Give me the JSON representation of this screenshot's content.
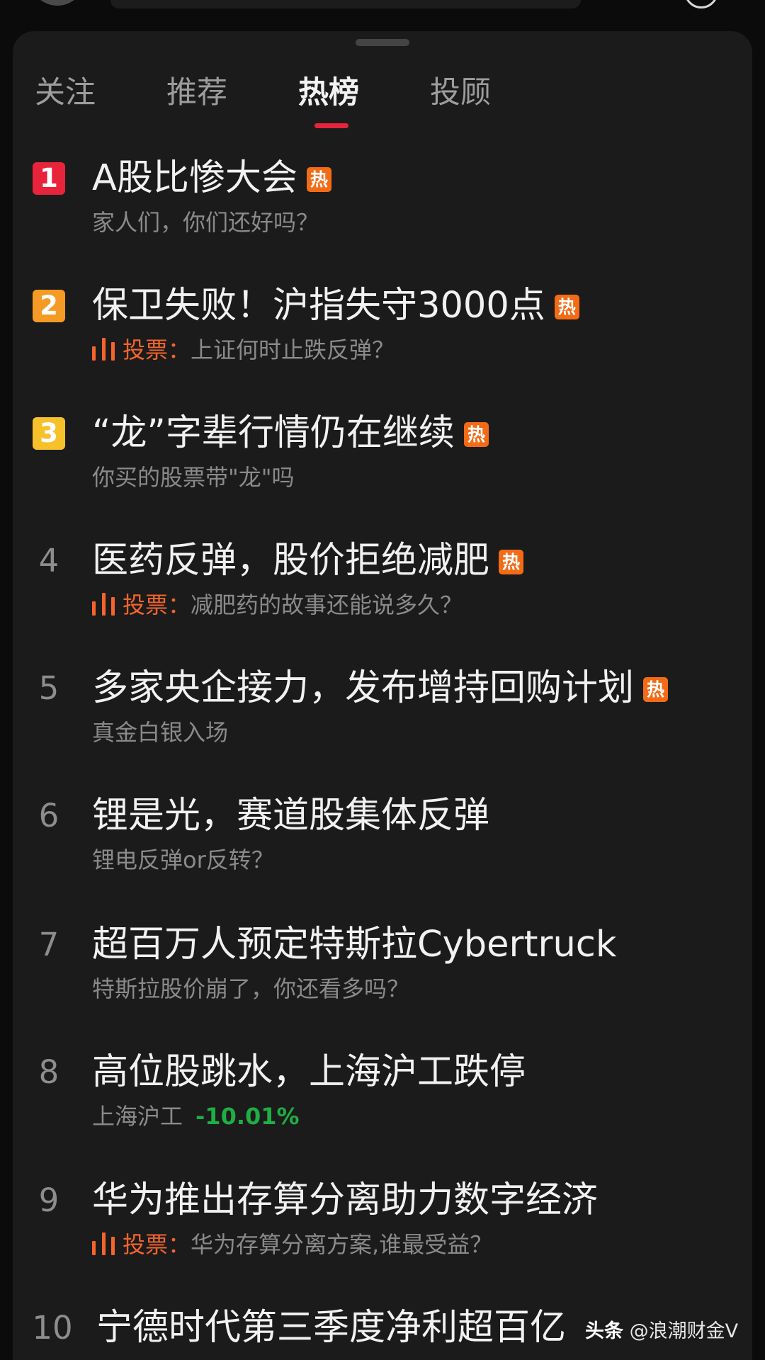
{
  "tabs": [
    {
      "label": "关注",
      "active": false
    },
    {
      "label": "推荐",
      "active": false
    },
    {
      "label": "热榜",
      "active": true
    },
    {
      "label": "投顾",
      "active": false
    }
  ],
  "hot_tag": "热",
  "vote_label": "投票：",
  "items": [
    {
      "rank": "1",
      "title": "A股比惨大会",
      "hot": true,
      "subtitle": "家人们，你们还好吗？",
      "badge_color": "#e8233c"
    },
    {
      "rank": "2",
      "title": "保卫失败！沪指失守3000点",
      "hot": true,
      "vote": true,
      "subtitle": "上证何时止跌反弹？",
      "badge_color": "#f49a25"
    },
    {
      "rank": "3",
      "title": "“龙”字辈行情仍在继续",
      "hot": true,
      "subtitle": "你买的股票带\"龙\"吗",
      "badge_color": "#f6c12a"
    },
    {
      "rank": "4",
      "title": "医药反弹，股价拒绝减肥",
      "hot": true,
      "vote": true,
      "subtitle": "减肥药的故事还能说多久？"
    },
    {
      "rank": "5",
      "title": "多家央企接力，发布增持回购计划",
      "hot": true,
      "subtitle": "真金白银入场"
    },
    {
      "rank": "6",
      "title": "锂是光，赛道股集体反弹",
      "subtitle": "锂电反弹or反转？"
    },
    {
      "rank": "7",
      "title": "超百万人预定特斯拉Cybertruck",
      "subtitle": "特斯拉股价崩了，你还看多吗？"
    },
    {
      "rank": "8",
      "title": "高位股跳水，上海沪工跌停",
      "subtitle": "上海沪工",
      "stock_change": "-10.01%"
    },
    {
      "rank": "9",
      "title": "华为推出存算分离助力数字经济",
      "vote": true,
      "subtitle": "华为存算分离方案,谁最受益？"
    },
    {
      "rank": "10",
      "title": "宁德时代第三季度净利超百亿"
    }
  ],
  "watermark": {
    "logo": "头条",
    "text": "@浪潮财金V"
  },
  "colors": {
    "background": "#1b1b1b",
    "accent_red": "#e8233c",
    "vote_orange": "#f3652b",
    "hot_tag_orange": "#f36b16",
    "down_green": "#1fad44"
  },
  "icons": {
    "vote": "bar-chart-icon",
    "avatar": "avatar-icon"
  }
}
